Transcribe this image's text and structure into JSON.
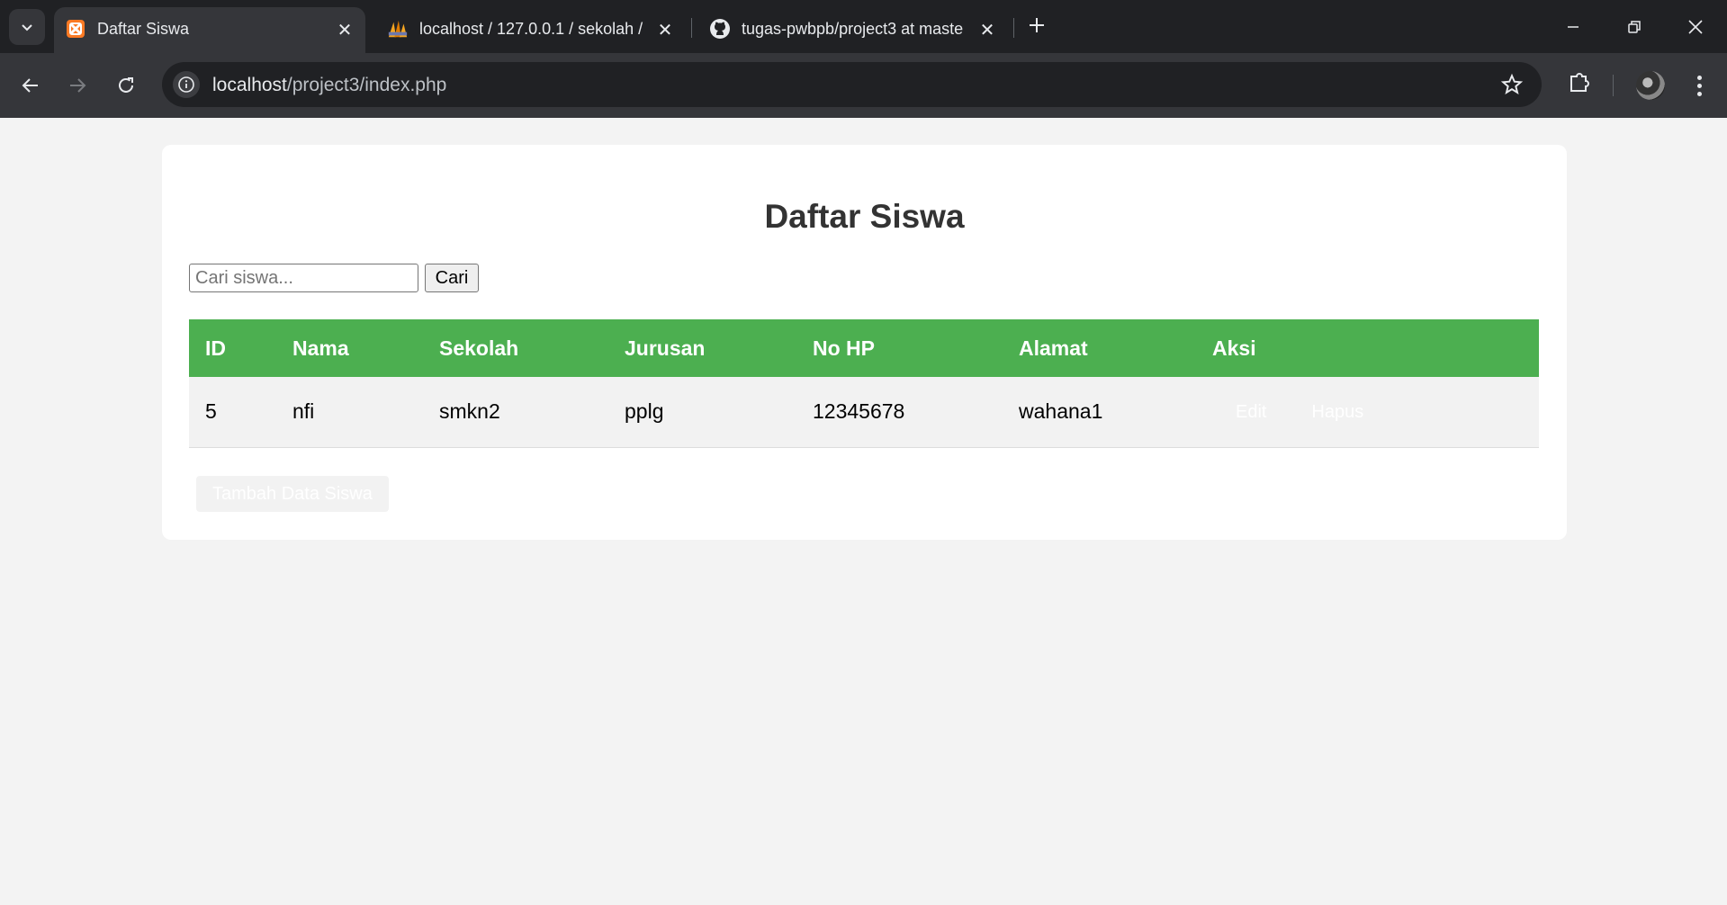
{
  "browser": {
    "tabs": [
      {
        "title": "Daftar Siswa",
        "icon": "xampp-icon",
        "active": true
      },
      {
        "title": "localhost / 127.0.0.1 / sekolah / ",
        "icon": "phpmyadmin-icon",
        "active": false
      },
      {
        "title": "tugas-pwbpb/project3 at maste",
        "icon": "github-icon",
        "active": false
      }
    ],
    "url_host": "localhost",
    "url_path": "/project3/index.php"
  },
  "page": {
    "title": "Daftar Siswa",
    "search": {
      "placeholder": "Cari siswa...",
      "value": "",
      "button_label": "Cari"
    },
    "table": {
      "headers": [
        "ID",
        "Nama",
        "Sekolah",
        "Jurusan",
        "No HP",
        "Alamat",
        "Aksi"
      ],
      "rows": [
        {
          "id": "5",
          "nama": "nfi",
          "sekolah": "smkn2",
          "jurusan": "pplg",
          "no_hp": "12345678",
          "alamat": "wahana1",
          "edit_label": "Edit",
          "delete_label": "Hapus"
        }
      ]
    },
    "add_button_label": "Tambah Data Siswa"
  },
  "colors": {
    "header_green": "#4caf50",
    "page_bg": "#f3f3f3",
    "chrome_dark": "#202124",
    "chrome_toolbar": "#35363a"
  }
}
